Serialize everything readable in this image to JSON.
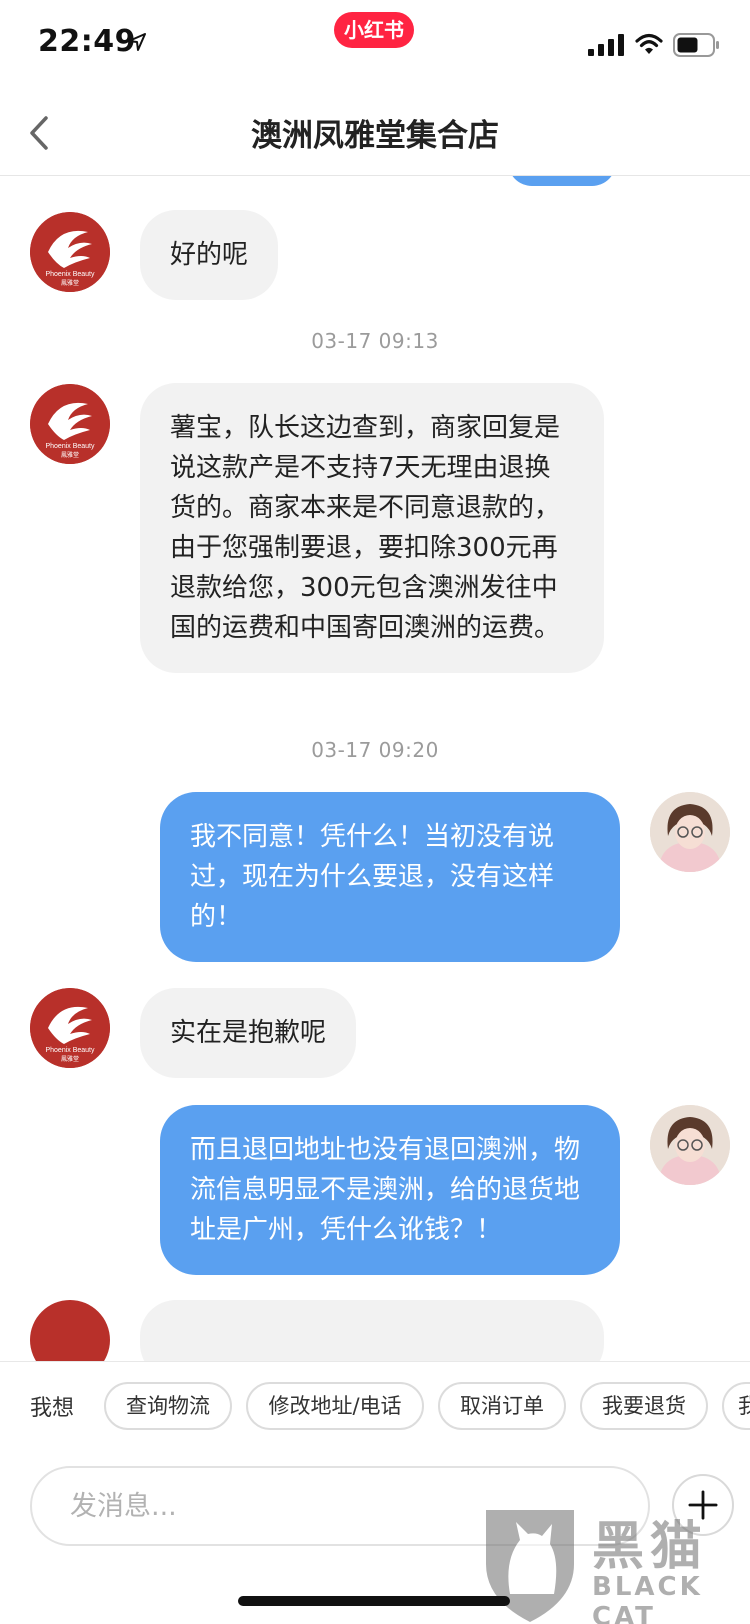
{
  "status_bar": {
    "time": "22:49",
    "app_badge": "小红书"
  },
  "nav": {
    "title": "澳洲凤雅堂集合店"
  },
  "chat": {
    "messages": [
      {
        "side": "in",
        "text": "好的呢"
      },
      {
        "timestamp": "03-17 09:13"
      },
      {
        "side": "in",
        "text": "薯宝，队长这边查到，商家回复是说这款产是不支持7天无理由退换货的。商家本来是不同意退款的，由于您强制要退，要扣除300元再退款给您，300元包含澳洲发往中国的运费和中国寄回澳洲的运费。"
      },
      {
        "timestamp": "03-17 09:20"
      },
      {
        "side": "out",
        "text": "我不同意！凭什么！当初没有说过，现在为什么要退，没有这样的！"
      },
      {
        "side": "in",
        "text": "实在是抱歉呢"
      },
      {
        "side": "out",
        "text": "而且退回地址也没有退回澳洲，物流信息明显不是澳洲，给的退货地址是广州，凭什么讹钱？！"
      }
    ],
    "shop_avatar_text": "Phoenix Beauty",
    "shop_avatar_cn": "鳳雅堂"
  },
  "quick_replies": {
    "label": "我想",
    "chips": [
      "查询物流",
      "修改地址/电话",
      "取消订单",
      "我要退货",
      "我"
    ]
  },
  "input": {
    "placeholder": "发消息..."
  },
  "watermark": {
    "cn": "黑猫",
    "en": "BLACK CAT"
  },
  "colors": {
    "brand_red": "#ff2442",
    "outgoing_bubble": "#5aa0f0",
    "incoming_bubble": "#f2f2f2",
    "shop_avatar": "#b8302a"
  }
}
